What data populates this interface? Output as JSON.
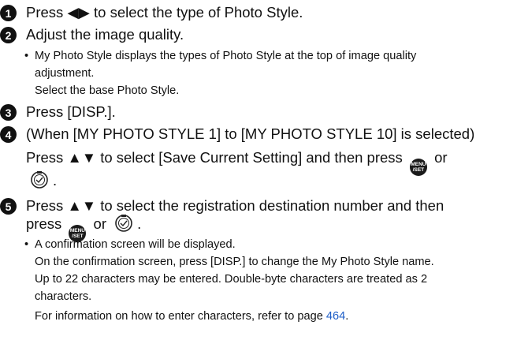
{
  "icons": {
    "menu_set": "menu-set-button-icon",
    "dial": "control-dial-icon",
    "left_right": "left-right-arrow-icon",
    "up_down": "up-down-arrow-icon"
  },
  "colors": {
    "link": "#1f5fc8"
  },
  "menu_button": {
    "top": "MENU",
    "bottom": "/SET"
  },
  "steps": [
    {
      "num": "1",
      "pre": "Press ",
      "arrows": "◀▶",
      "post": " to select the type of Photo Style."
    },
    {
      "num": "2",
      "text": "Adjust the image quality.",
      "bullet": "My Photo Style displays the types of Photo Style at the top of image quality",
      "bullet_cont": "adjustment.",
      "note": "Select the base Photo Style."
    },
    {
      "num": "3",
      "text": "Press [DISP.]."
    },
    {
      "num": "4",
      "line1": "(When [MY PHOTO STYLE 1] to [MY PHOTO STYLE 10] is selected)",
      "line2_pre": "Press ",
      "arrows": "▲▼",
      "line2_post": " to select [Save Current Setting] and then press ",
      "or": "or",
      "line3_post": "."
    },
    {
      "num": "5",
      "line1_pre": "Press ",
      "arrows": "▲▼",
      "line1_post": " to select the registration destination number and then",
      "line2_pre": "press ",
      "or": "or",
      "line2_post": ".",
      "bullet": "A confirmation screen will be displayed.",
      "lines": [
        "On the confirmation screen, press [DISP.] to change the My Photo Style name.",
        "Up to 22 characters may be entered. Double-byte characters are treated as 2",
        "characters."
      ],
      "ref_pre": "For information on how to enter characters, refer to page ",
      "ref_page": "464",
      "ref_post": "."
    }
  ]
}
